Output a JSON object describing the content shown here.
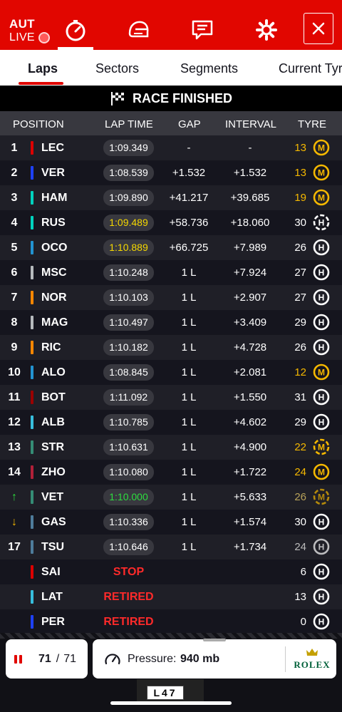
{
  "header": {
    "session_code": "AUT",
    "live_label": "LIVE",
    "icons": [
      "timer-icon",
      "helmet-icon",
      "messages-icon",
      "settings-icon",
      "close-icon"
    ]
  },
  "tabs": [
    "Laps",
    "Sectors",
    "Segments",
    "Current Tyres"
  ],
  "banner": "RACE FINISHED",
  "columns": {
    "position": "POSITION",
    "lap_time": "LAP TIME",
    "gap": "GAP",
    "interval": "INTERVAL",
    "tyre": "TYRE"
  },
  "colors": {
    "brand": "#e10600",
    "purple": "#f5d800",
    "green": "#2dde3f",
    "red_status": "#ff2a2a",
    "medium": "#f5b800",
    "hard": "#ffffff"
  },
  "rows": [
    {
      "pos": "1",
      "driver": "LEC",
      "team_color": "#dc0000",
      "lap_time": "1:09.349",
      "lap_style": "normal",
      "gap": "-",
      "interval": "-",
      "laps": "13",
      "laps_color": "#f5b800",
      "tyre": "M",
      "tyre_new": true
    },
    {
      "pos": "2",
      "driver": "VER",
      "team_color": "#1e41ff",
      "lap_time": "1:08.539",
      "lap_style": "normal",
      "gap": "+1.532",
      "interval": "+1.532",
      "laps": "13",
      "laps_color": "#f5b800",
      "tyre": "M",
      "tyre_new": true
    },
    {
      "pos": "3",
      "driver": "HAM",
      "team_color": "#00d2be",
      "lap_time": "1:09.890",
      "lap_style": "normal",
      "gap": "+41.217",
      "interval": "+39.685",
      "laps": "19",
      "laps_color": "#f5b800",
      "tyre": "M",
      "tyre_new": true
    },
    {
      "pos": "4",
      "driver": "RUS",
      "team_color": "#00d2be",
      "lap_time": "1:09.489",
      "lap_style": "yellow",
      "gap": "+58.736",
      "interval": "+18.060",
      "laps": "30",
      "laps_color": "#ffffff",
      "tyre": "H",
      "tyre_new": false
    },
    {
      "pos": "5",
      "driver": "OCO",
      "team_color": "#2293d1",
      "lap_time": "1:10.889",
      "lap_style": "yellow",
      "gap": "+66.725",
      "interval": "+7.989",
      "laps": "26",
      "laps_color": "#ffffff",
      "tyre": "H",
      "tyre_new": true
    },
    {
      "pos": "6",
      "driver": "MSC",
      "team_color": "#b6babd",
      "lap_time": "1:10.248",
      "lap_style": "normal",
      "gap": "1 L",
      "interval": "+7.924",
      "laps": "27",
      "laps_color": "#ffffff",
      "tyre": "H",
      "tyre_new": true
    },
    {
      "pos": "7",
      "driver": "NOR",
      "team_color": "#ff8700",
      "lap_time": "1:10.103",
      "lap_style": "normal",
      "gap": "1 L",
      "interval": "+2.907",
      "laps": "27",
      "laps_color": "#ffffff",
      "tyre": "H",
      "tyre_new": true
    },
    {
      "pos": "8",
      "driver": "MAG",
      "team_color": "#b6babd",
      "lap_time": "1:10.497",
      "lap_style": "normal",
      "gap": "1 L",
      "interval": "+3.409",
      "laps": "29",
      "laps_color": "#ffffff",
      "tyre": "H",
      "tyre_new": true
    },
    {
      "pos": "9",
      "driver": "RIC",
      "team_color": "#ff8700",
      "lap_time": "1:10.182",
      "lap_style": "normal",
      "gap": "1 L",
      "interval": "+4.728",
      "laps": "26",
      "laps_color": "#ffffff",
      "tyre": "H",
      "tyre_new": true
    },
    {
      "pos": "10",
      "driver": "ALO",
      "team_color": "#2293d1",
      "lap_time": "1:08.845",
      "lap_style": "normal",
      "gap": "1 L",
      "interval": "+2.081",
      "laps": "12",
      "laps_color": "#f5b800",
      "tyre": "M",
      "tyre_new": true
    },
    {
      "pos": "11",
      "driver": "BOT",
      "team_color": "#9b0000",
      "lap_time": "1:11.092",
      "lap_style": "normal",
      "gap": "1 L",
      "interval": "+1.550",
      "laps": "31",
      "laps_color": "#ffffff",
      "tyre": "H",
      "tyre_new": true
    },
    {
      "pos": "12",
      "driver": "ALB",
      "team_color": "#37bedd",
      "lap_time": "1:10.785",
      "lap_style": "normal",
      "gap": "1 L",
      "interval": "+4.602",
      "laps": "29",
      "laps_color": "#ffffff",
      "tyre": "H",
      "tyre_new": true
    },
    {
      "pos": "13",
      "driver": "STR",
      "team_color": "#358c75",
      "lap_time": "1:10.631",
      "lap_style": "normal",
      "gap": "1 L",
      "interval": "+4.900",
      "laps": "22",
      "laps_color": "#f5b800",
      "tyre": "M",
      "tyre_new": false
    },
    {
      "pos": "14",
      "driver": "ZHO",
      "team_color": "#b12039",
      "lap_time": "1:10.080",
      "lap_style": "normal",
      "gap": "1 L",
      "interval": "+1.722",
      "laps": "24",
      "laps_color": "#f5b800",
      "tyre": "M",
      "tyre_new": true
    },
    {
      "pos": "↑",
      "driver": "VET",
      "team_color": "#358c75",
      "lap_time": "1:10.000",
      "lap_style": "green",
      "gap": "1 L",
      "interval": "+5.633",
      "laps": "26",
      "laps_color": "#b8a25a",
      "tyre": "M",
      "tyre_new": false,
      "pos_color": "#2dde3f",
      "dim": true
    },
    {
      "pos": "↓",
      "driver": "GAS",
      "team_color": "#4e7c9b",
      "lap_time": "1:10.336",
      "lap_style": "normal",
      "gap": "1 L",
      "interval": "+1.574",
      "laps": "30",
      "laps_color": "#ffffff",
      "tyre": "H",
      "tyre_new": true,
      "pos_color": "#f5b800"
    },
    {
      "pos": "17",
      "driver": "TSU",
      "team_color": "#4e7c9b",
      "lap_time": "1:10.646",
      "lap_style": "normal",
      "gap": "1 L",
      "interval": "+1.734",
      "laps": "24",
      "laps_color": "#bbbbbb",
      "tyre": "H",
      "tyre_new": true,
      "dim": true
    },
    {
      "pos": "",
      "driver": "SAI",
      "team_color": "#dc0000",
      "lap_time": "STOP",
      "lap_style": "status",
      "gap": "",
      "interval": "",
      "laps": "6",
      "laps_color": "#ffffff",
      "tyre": "H",
      "tyre_new": true
    },
    {
      "pos": "",
      "driver": "LAT",
      "team_color": "#37bedd",
      "lap_time": "RETIRED",
      "lap_style": "status",
      "gap": "",
      "interval": "",
      "laps": "13",
      "laps_color": "#ffffff",
      "tyre": "H",
      "tyre_new": true
    },
    {
      "pos": "",
      "driver": "PER",
      "team_color": "#1e41ff",
      "lap_time": "RETIRED",
      "lap_style": "status",
      "gap": "",
      "interval": "",
      "laps": "0",
      "laps_color": "#ffffff",
      "tyre": "H",
      "tyre_new": true
    }
  ],
  "footer": {
    "laps_current": "71",
    "laps_sep": "/",
    "laps_total": "71",
    "pressure_label": "Pressure:",
    "pressure_value": "940 mb",
    "sponsor": "ROLEX",
    "car_number": "L47"
  }
}
